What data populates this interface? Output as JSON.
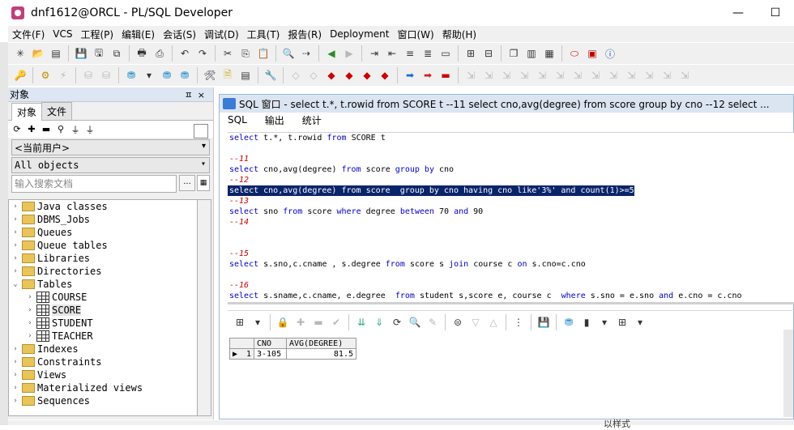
{
  "window": {
    "title": "dnf1612@ORCL - PL/SQL Developer",
    "controls": [
      "—",
      "☐"
    ]
  },
  "menubar": [
    "文件(F)",
    "VCS",
    "工程(P)",
    "编辑(E)",
    "会话(S)",
    "调试(D)",
    "工具(T)",
    "报告(R)",
    "Deployment",
    "窗口(W)",
    "帮助(H)"
  ],
  "left_panel": {
    "header": "对象",
    "pin_icons": "ㅍ×",
    "tabs": [
      "对象",
      "文件"
    ],
    "user_combo": "<当前用户>",
    "objects_combo": "All objects",
    "search_placeholder": "输入搜索文档",
    "search_btn": "...",
    "tree": [
      {
        "label": "Java classes",
        "type": "folder",
        "expanded": false
      },
      {
        "label": "DBMS_Jobs",
        "type": "folder",
        "expanded": false
      },
      {
        "label": "Queues",
        "type": "folder",
        "expanded": false
      },
      {
        "label": "Queue tables",
        "type": "folder",
        "expanded": false
      },
      {
        "label": "Libraries",
        "type": "folder",
        "expanded": false
      },
      {
        "label": "Directories",
        "type": "folder",
        "expanded": false
      },
      {
        "label": "Tables",
        "type": "folder",
        "expanded": true
      },
      {
        "label": "COURSE",
        "type": "table",
        "expanded": false
      },
      {
        "label": "SCORE",
        "type": "table",
        "expanded": false,
        "selected": true
      },
      {
        "label": "STUDENT",
        "type": "table",
        "expanded": false
      },
      {
        "label": "TEACHER",
        "type": "table",
        "expanded": false
      },
      {
        "label": "Indexes",
        "type": "folder",
        "expanded": false
      },
      {
        "label": "Constraints",
        "type": "folder",
        "expanded": false
      },
      {
        "label": "Views",
        "type": "folder",
        "expanded": false
      },
      {
        "label": "Materialized views",
        "type": "folder",
        "expanded": false
      },
      {
        "label": "Sequences",
        "type": "folder",
        "expanded": false
      }
    ]
  },
  "sql_window": {
    "title": "SQL 窗口 - select t.*, t.rowid from SCORE t --11 select cno,avg(degree) from score group by cno --12 select ...",
    "tabs": [
      "SQL",
      "输出",
      "统计"
    ]
  },
  "editor_lines": [
    {
      "text": "select t.*, t.rowid from SCORE t",
      "type": "code"
    },
    {
      "text": "",
      "type": "blank"
    },
    {
      "text": "--11",
      "type": "comment"
    },
    {
      "text": "select cno,avg(degree) from score group by cno",
      "type": "code"
    },
    {
      "text": "--12",
      "type": "comment"
    },
    {
      "text": "select cno,avg(degree) from score  group by cno having cno like'3%' and count(1)>=5",
      "type": "highlight"
    },
    {
      "text": "--13",
      "type": "comment"
    },
    {
      "text": "select sno from score where degree between 70 and 90",
      "type": "code"
    },
    {
      "text": "--14",
      "type": "comment"
    },
    {
      "text": "",
      "type": "blank"
    },
    {
      "text": "",
      "type": "blank"
    },
    {
      "text": "--15",
      "type": "comment"
    },
    {
      "text": "select s.sno,c.cname , s.degree from score s join course c on s.cno=c.cno",
      "type": "code"
    },
    {
      "text": "",
      "type": "blank"
    },
    {
      "text": "--16",
      "type": "comment"
    },
    {
      "text": "select s.sname,c.cname, e.degree  from student s,score e, course c  where s.sno = e.sno and e.cno = c.cno",
      "type": "code"
    }
  ],
  "result_grid": {
    "columns": [
      "",
      "CNO",
      "AVG(DEGREE)"
    ],
    "rows": [
      {
        "num": "1",
        "cno": "3-105",
        "avg": "81.5"
      }
    ]
  },
  "bottom_text": "以样式"
}
